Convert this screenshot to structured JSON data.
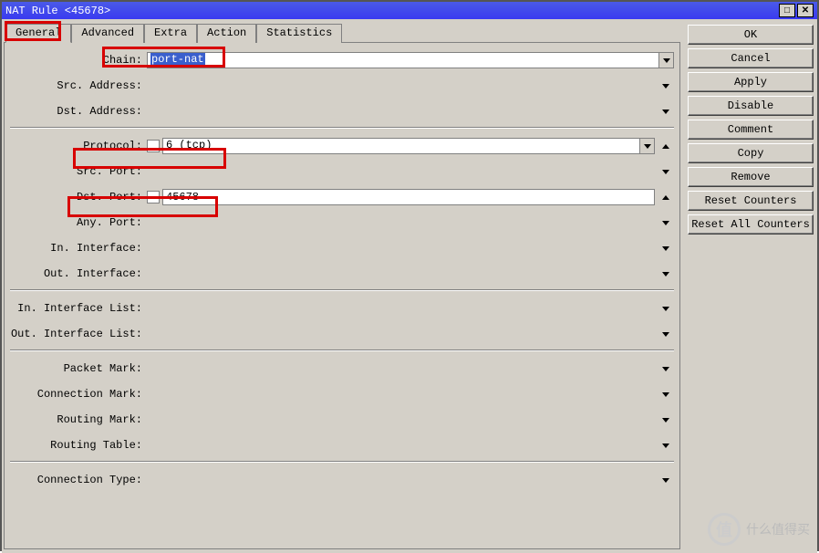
{
  "title": "NAT Rule <45678>",
  "tabs": {
    "general": "General",
    "advanced": "Advanced",
    "extra": "Extra",
    "action": "Action",
    "statistics": "Statistics"
  },
  "labels": {
    "chain": "Chain:",
    "srcaddr": "Src. Address:",
    "dstaddr": "Dst. Address:",
    "protocol": "Protocol:",
    "srcport": "Src. Port:",
    "dstport": "Dst. Port:",
    "anyport": "Any. Port:",
    "inif": "In. Interface:",
    "outif": "Out. Interface:",
    "iniflist": "In. Interface List:",
    "outiflist": "Out. Interface List:",
    "pktmark": "Packet Mark:",
    "connmark": "Connection Mark:",
    "rtmark": "Routing Mark:",
    "rttable": "Routing Table:",
    "conntype": "Connection Type:"
  },
  "values": {
    "chain": "port-nat",
    "protocol": "6 (tcp)",
    "dstport": "45678"
  },
  "buttons": {
    "ok": "OK",
    "cancel": "Cancel",
    "apply": "Apply",
    "disable": "Disable",
    "comment": "Comment",
    "copy": "Copy",
    "remove": "Remove",
    "resetc": "Reset Counters",
    "resetac": "Reset All Counters"
  },
  "watermark": {
    "icon": "值",
    "text": "什么值得买"
  }
}
